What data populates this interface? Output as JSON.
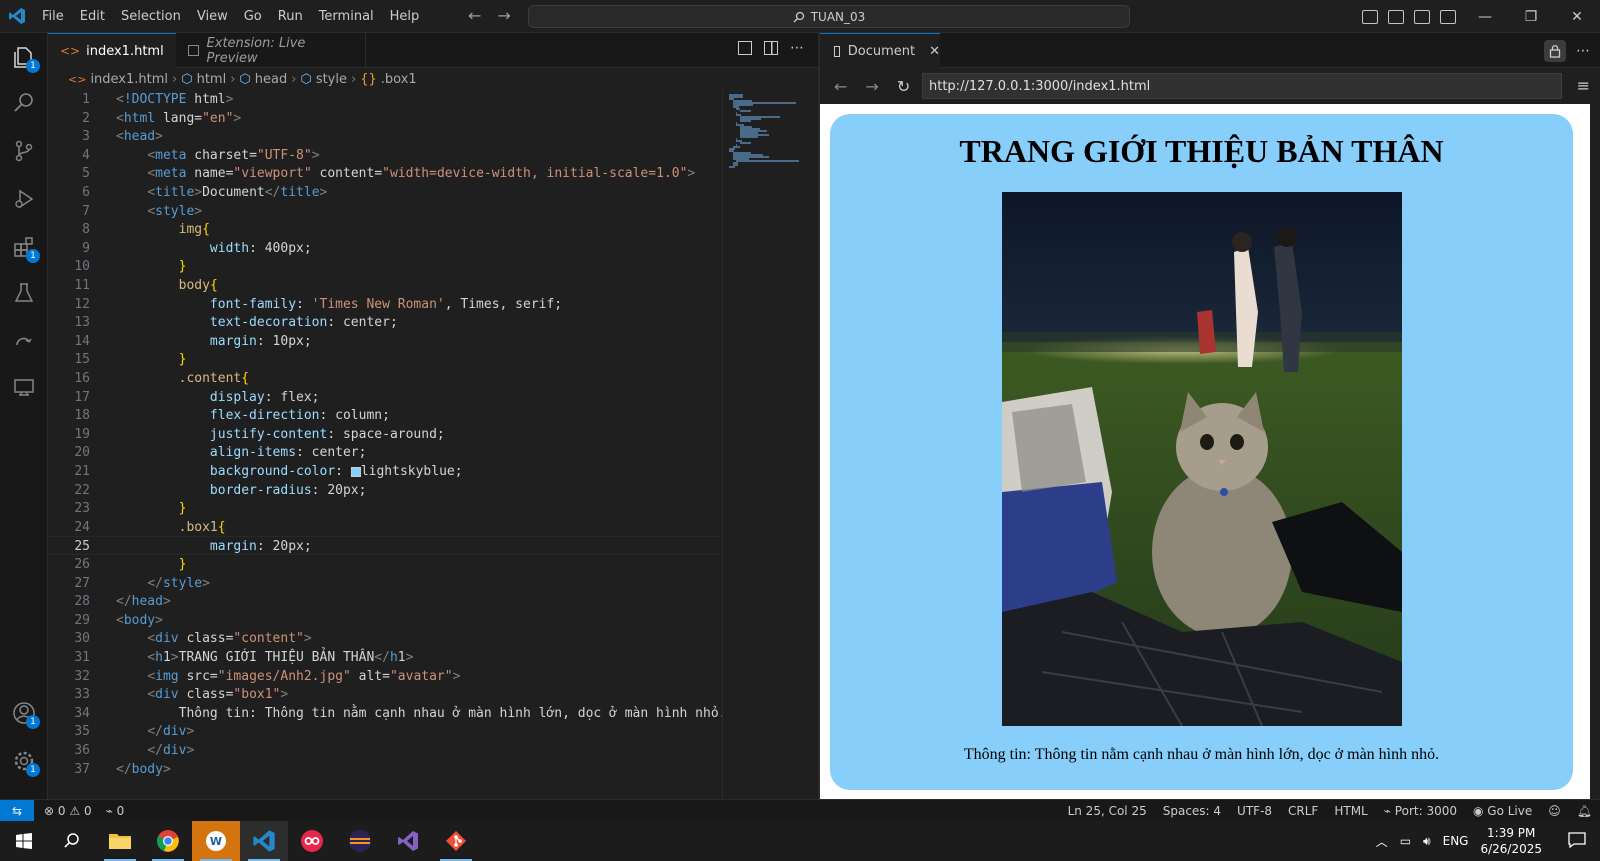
{
  "titlebar": {
    "menu": [
      "File",
      "Edit",
      "Selection",
      "View",
      "Go",
      "Run",
      "Terminal",
      "Help"
    ],
    "search_text": "TUAN_03"
  },
  "activity": {
    "explorer_badge": "1",
    "extensions_badge": "1",
    "accounts_badge": "1",
    "settings_badge": "1"
  },
  "editor": {
    "tabs": [
      {
        "label": "index1.html",
        "dirty": true
      },
      {
        "label": "Extension: Live Preview"
      }
    ],
    "breadcrumb": [
      "index1.html",
      "html",
      "head",
      "style",
      ".box1"
    ],
    "current_line": 25,
    "lines": [
      "<!DOCTYPE html>",
      "<html lang=\"en\">",
      "<head>",
      "    <meta charset=\"UTF-8\">",
      "    <meta name=\"viewport\" content=\"width=device-width, initial-scale=1.0\">",
      "    <title>Document</title>",
      "    <style>",
      "        img{",
      "            width: 400px;",
      "        }",
      "        body{",
      "            font-family: 'Times New Roman', Times, serif;",
      "            text-decoration: center;",
      "            margin: 10px;",
      "        }",
      "        .content{",
      "            display: flex;",
      "            flex-direction: column;",
      "            justify-content: space-around;",
      "            align-items: center;",
      "            background-color: ■lightskyblue;",
      "            border-radius: 20px;",
      "        }",
      "        .box1{",
      "            margin: 20px;",
      "        }",
      "    </style>",
      "</head>",
      "<body>",
      "    <div class=\"content\">",
      "    <h1>TRANG GIỚI THIỆU BẢN THÂN</h1>",
      "    <img src=\"images/Anh2.jpg\" alt=\"avatar\">",
      "    <div class=\"box1\">",
      "        Thông tin: Thông tin nằm cạnh nhau ở màn hình lớn, dọc ở màn hình nhỏ.",
      "    </div>",
      "    </div>",
      "</body>"
    ]
  },
  "preview": {
    "tab_label": "Document",
    "url": "http://127.0.0.1:3000/index1.html",
    "heading": "TRANG GIỚI THIỆU BẢN THÂN",
    "image_alt": "avatar",
    "info_text": "Thông tin: Thông tin nằm cạnh nhau ở màn hình lớn, dọc ở màn hình nhỏ.",
    "bg_color": "#87cefa"
  },
  "statusbar": {
    "errors": "0",
    "warnings": "0",
    "ports": "0",
    "position": "Ln 25, Col 25",
    "spaces": "Spaces: 4",
    "encoding": "UTF-8",
    "eol": "CRLF",
    "language": "HTML",
    "port": "Port: 3000",
    "golive": "Go Live"
  },
  "taskbar": {
    "lang": "ENG",
    "time": "1:39 PM",
    "date": "6/26/2025"
  }
}
